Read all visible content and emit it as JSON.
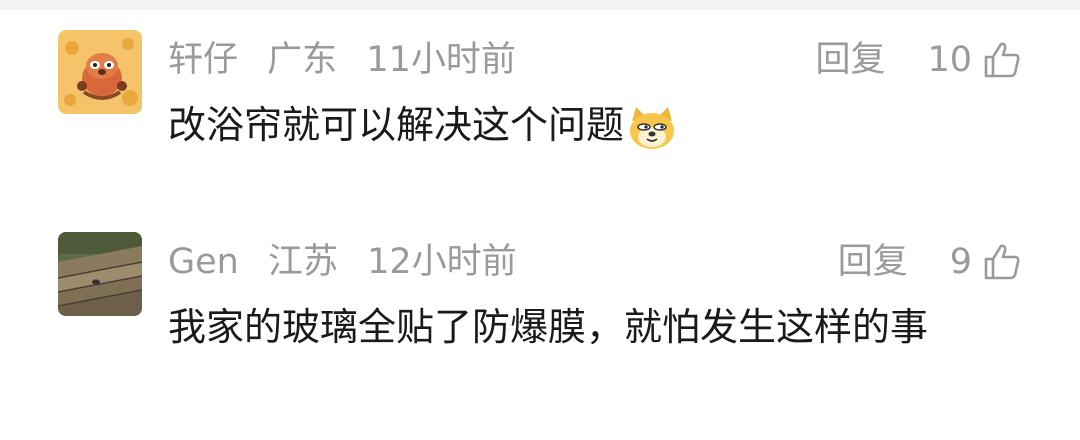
{
  "comments": [
    {
      "username": "轩仔",
      "location": "广东",
      "time": "11小时前",
      "reply_label": "回复",
      "likes": "10",
      "text": "改浴帘就可以解决这个问题",
      "avatar": "cartoon-raccoon-avatar",
      "emoji": "doge-emoji"
    },
    {
      "username": "Gen",
      "location": "江苏",
      "time": "12小时前",
      "reply_label": "回复",
      "likes": "9",
      "text": "我家的玻璃全贴了防爆膜，就怕发生这样的事",
      "avatar": "wooden-boards-photo-avatar"
    }
  ],
  "colors": {
    "meta": "#9a9a9a",
    "text": "#1a1a1a",
    "divider": "#f2f2f2"
  }
}
